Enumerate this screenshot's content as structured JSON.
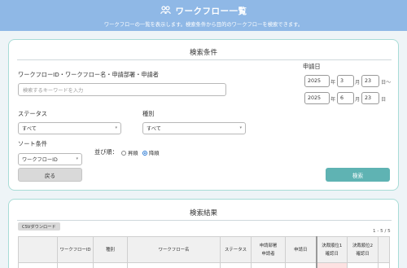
{
  "header": {
    "title": "ワークフロー一覧",
    "subtitle": "ワークフローの一覧を表示します。検索条件から目的のワークフローを検索できます。",
    "icon": "users-icon",
    "bg_color": "#8fb8e6"
  },
  "search": {
    "title": "検索条件",
    "keyword_label": "ワークフローID・ワークフロー名・申請部署・申請者",
    "keyword_placeholder": "検索するキーワードを入力",
    "keyword_value": "",
    "date_label": "申請日",
    "date_from": {
      "year": "2025",
      "year_unit": "年",
      "month": "3",
      "month_unit": "月",
      "day": "23",
      "day_unit": "日〜"
    },
    "date_to": {
      "year": "2025",
      "year_unit": "年",
      "month": "6",
      "month_unit": "月",
      "day": "23",
      "day_unit": "日"
    },
    "status_label": "ステータス",
    "status_value": "すべて",
    "type_label": "種別",
    "type_value": "すべて",
    "sort_label": "ソート条件",
    "sort_value": "ワークフローID",
    "order_label": "並び順：",
    "order_asc": "昇順",
    "order_desc": "降順",
    "order_selected": "desc",
    "back_button": "戻る",
    "search_button": "検索",
    "accent_color": "#5fb3b3"
  },
  "results": {
    "title": "検索結果",
    "csv_button": "CSVダウンロード",
    "count": "1 - 5 / 5",
    "columns": [
      {
        "line1": "",
        "line2": ""
      },
      {
        "line1": "ワークフローID",
        "line2": ""
      },
      {
        "line1": "種別",
        "line2": ""
      },
      {
        "line1": "ワークフロー名",
        "line2": ""
      },
      {
        "line1": "ステータス",
        "line2": ""
      },
      {
        "line1": "申請部署",
        "line2": "申請者"
      },
      {
        "line1": "申請日",
        "line2": ""
      },
      {
        "line1": "決裁順位1",
        "line2": "確認日"
      },
      {
        "line1": "決裁順位2",
        "line2": "確認日"
      },
      {
        "line1": "",
        "line2": ""
      }
    ]
  }
}
